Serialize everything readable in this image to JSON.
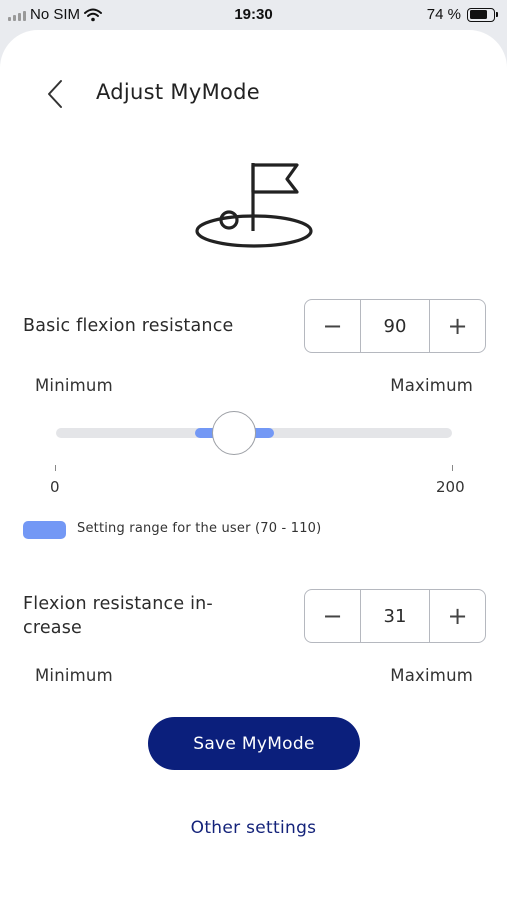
{
  "status_bar": {
    "carrier": "No SIM",
    "time": "19:30",
    "battery_text": "74 %",
    "battery_level": 0.74
  },
  "header": {
    "title": "Adjust MyMode",
    "back_icon": "chevron-left-icon"
  },
  "mode_icon": "golf-flag-icon",
  "flexion_resistance": {
    "label": "Basic flexion resistance",
    "value": "90",
    "decrement_label": "−",
    "increment_label": "+",
    "min_label": "Minimum",
    "max_label": "Maximum",
    "slider": {
      "min": 0,
      "max": 200,
      "value": 90,
      "user_range": [
        70,
        110
      ],
      "min_tick_label": "0",
      "max_tick_label": "200"
    },
    "legend_text": "Setting range for the user (70 - 110)"
  },
  "resistance_increase": {
    "label_line1": "Flexion resistance in-",
    "label_line2": "crease",
    "value": "31",
    "decrement_label": "−",
    "increment_label": "+",
    "min_label": "Minimum",
    "max_label": "Maximum"
  },
  "actions": {
    "save_label": "Save MyMode",
    "other_settings_label": "Other settings"
  },
  "colors": {
    "primary": "#0b1f7c",
    "range": "#7398f5",
    "link": "#14237a"
  }
}
